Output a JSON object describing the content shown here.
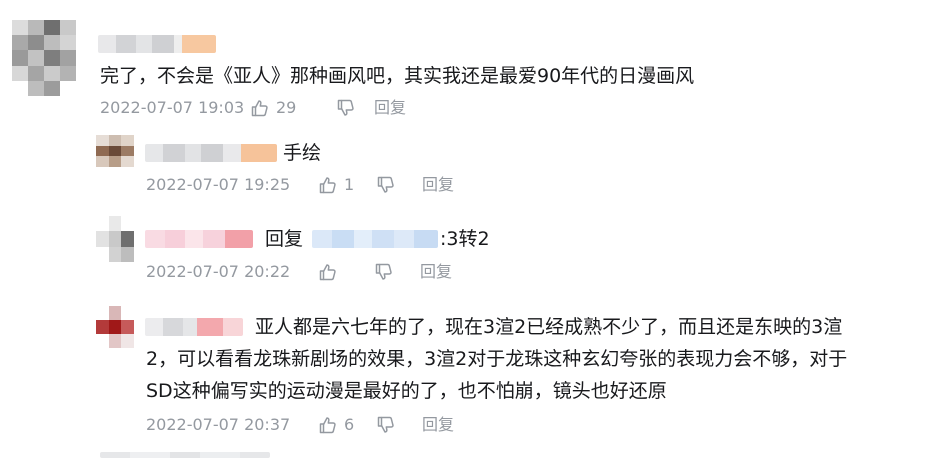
{
  "comments": [
    {
      "text": "完了，不会是《亚人》那种画风吧，其实我还是最爱90年代的日漫画风",
      "time": "2022-07-07 19:03",
      "likes": "29",
      "reply_label": "回复"
    }
  ],
  "replies": [
    {
      "text": "手绘",
      "time": "2022-07-07 19:25",
      "likes": "1",
      "reply_label": "回复"
    },
    {
      "reply_prefix": "回复",
      "text": ":3转2",
      "time": "2022-07-07 20:22",
      "likes": "",
      "reply_label": "回复"
    },
    {
      "lines": [
        "亚人都是六七年的了，现在3渲2已经成熟不少了，而且还是东映的3渲",
        "2，可以看看龙珠新剧场的效果，3渲2对于龙珠这种玄幻夸张的表现力会不够，对于",
        "SD这种偏写实的运动漫是最好的了，也不怕崩，镜头也好还原"
      ],
      "time": "2022-07-07 20:37",
      "likes": "6",
      "reply_label": "回复"
    }
  ],
  "colors": {
    "meta": "#9499a0",
    "text": "#18191c"
  },
  "icons": [
    "thumb-up-icon",
    "thumb-down-icon"
  ]
}
